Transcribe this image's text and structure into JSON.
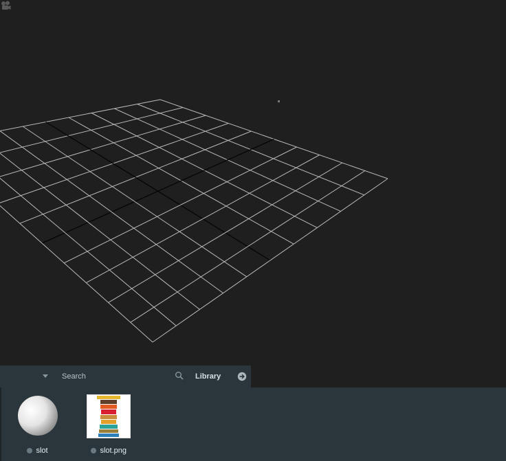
{
  "toolbar": {
    "search_placeholder": "Search",
    "library_label": "Library",
    "filter_icon": "triangle-down-icon",
    "search_icon": "magnifier-icon",
    "library_icon": "arrow-circle-right-icon"
  },
  "viewport": {
    "background": "#1f1f1f",
    "grid_color": "#b9b9b9",
    "axis_color": "#050505",
    "camera_icon": "camera-icon"
  },
  "assets": [
    {
      "name": "slot",
      "kind": "model",
      "thumbnail": "sphere"
    },
    {
      "name": "slot.png",
      "kind": "image",
      "thumbnail": "slot-strip"
    }
  ],
  "colors": {
    "panel": "#2a363c",
    "status_dot": "#6b7a80"
  }
}
